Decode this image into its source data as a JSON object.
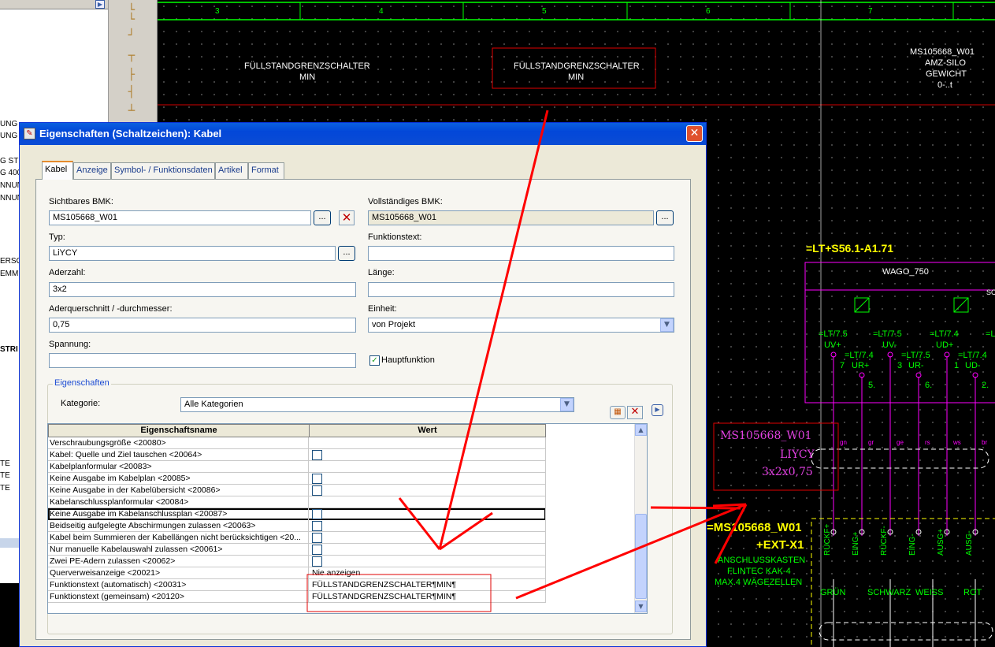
{
  "left_panel": {
    "texts": [
      "UNG",
      "UNG",
      "G STE",
      "G 400",
      "NNUN",
      "NNUN",
      "ERSC",
      "EMMI",
      "STRI",
      "TE",
      "TE",
      "TE"
    ]
  },
  "cad": {
    "columns": [
      "3",
      "4",
      "5",
      "6",
      "7"
    ],
    "switch1_line1": "FÜLLSTANDGRENZSCHALTER",
    "switch1_line2": "MIN",
    "switch2_line1": "FÜLLSTANDGRENZSCHALTER",
    "switch2_line2": "MIN",
    "silo_line1": "MS105668_W01",
    "silo_line2": "AMZ-SILO",
    "silo_line3": "GEWICHT",
    "silo_line4": "0-..t",
    "device_ref": "=LT+S56.1-A1.71",
    "wago": "WAGO_750",
    "wago_sc": "SC",
    "terminals_row1": [
      "=LT/7.5",
      "=LT/7.5",
      "=LT/7.4",
      "=LT"
    ],
    "terminals_row1b": [
      "UV+",
      "UV-",
      "UD+"
    ],
    "terminals_row2": [
      "7",
      "=LT/7.4",
      "3",
      "=LT/7.5",
      "1",
      "=LT/7.4"
    ],
    "terminals_row2b": [
      "UR+",
      "UR-",
      "UD-"
    ],
    "terminals_row3": [
      "5.",
      "6.",
      "2."
    ],
    "cable_bmk": "MS105668_W01",
    "cable_type": "LIYCY",
    "cable_size": "3x2x0,75",
    "wire_colors": [
      "gn",
      "gr",
      "ge",
      "rs",
      "ws",
      "br"
    ],
    "box_line1": "=MS105668_W01",
    "box_line2": "+EXT-X1",
    "box_line3": "ANSCHLUSSKASTEN",
    "box_line4": "FLINTEC KAK-4",
    "box_line5": "MAX.4 WÄGEZELLEN",
    "pins": [
      "RÜCKF+",
      "EING+",
      "RÜCKF-",
      "EING-",
      "AUSG+",
      "AUSG-"
    ],
    "colors_bottom": [
      "GRÜN",
      "SCHWARZ",
      "WEISS",
      "ROT"
    ]
  },
  "dialog": {
    "title": "Eigenschaften (Schaltzeichen): Kabel",
    "close_label": "✕",
    "tabs": [
      "Kabel",
      "Anzeige",
      "Symbol- / Funktionsdaten",
      "Artikel",
      "Format"
    ],
    "sichtbares_bmk_label": "Sichtbares BMK:",
    "sichtbares_bmk_value": "MS105668_W01",
    "vollstaendiges_bmk_label": "Vollständiges BMK:",
    "vollstaendiges_bmk_value": "MS105668_W01",
    "typ_label": "Typ:",
    "typ_value": "LiYCY",
    "funktionstext_label": "Funktionstext:",
    "funktionstext_value": "",
    "aderzahl_label": "Aderzahl:",
    "aderzahl_value": "3x2",
    "laenge_label": "Länge:",
    "laenge_value": "",
    "aderquerschnitt_label": "Aderquerschnitt / -durchmesser:",
    "aderquerschnitt_value": "0,75",
    "einheit_label": "Einheit:",
    "einheit_value": "von Projekt",
    "spannung_label": "Spannung:",
    "spannung_value": "",
    "hauptfunktion_label": "Hauptfunktion",
    "hauptfunktion_checked": true,
    "ellipsis": "...",
    "group_title": "Eigenschaften",
    "kategorie_label": "Kategorie:",
    "kategorie_value": "Alle Kategorien",
    "grid": {
      "col_name": "Eigenschaftsname",
      "col_value": "Wert",
      "rows": [
        {
          "name": "Verschraubungsgröße <20080>",
          "value": "",
          "type": "text"
        },
        {
          "name": "Kabel: Quelle und Ziel tauschen <20064>",
          "value": "",
          "type": "check"
        },
        {
          "name": "Kabelplanformular <20083>",
          "value": "",
          "type": "text"
        },
        {
          "name": "Keine Ausgabe im Kabelplan <20085>",
          "value": "",
          "type": "check"
        },
        {
          "name": "Keine Ausgabe in der Kabelübersicht <20086>",
          "value": "",
          "type": "check"
        },
        {
          "name": "Kabelanschlussplanformular <20084>",
          "value": "",
          "type": "text"
        },
        {
          "name": "Keine Ausgabe im Kabelanschlussplan <20087>",
          "value": "",
          "type": "check"
        },
        {
          "name": "Beidseitig aufgelegte Abschirmungen zulassen <20063>",
          "value": "",
          "type": "check"
        },
        {
          "name": "Kabel beim Summieren der Kabellängen nicht berücksichtigen <20...",
          "value": "",
          "type": "check"
        },
        {
          "name": "Nur manuelle Kabelauswahl zulassen <20061>",
          "value": "",
          "type": "check"
        },
        {
          "name": "Zwei PE-Adern zulassen <20062>",
          "value": "",
          "type": "check"
        },
        {
          "name": "Querverweisanzeige <20021>",
          "value": "Nie anzeigen",
          "type": "text"
        },
        {
          "name": "Funktionstext (automatisch) <20031>",
          "value": "FÜLLSTANDGRENZSCHALTER¶MIN¶",
          "type": "text"
        },
        {
          "name": "Funktionstext (gemeinsam) <20120>",
          "value": "FÜLLSTANDGRENZSCHALTER¶MIN¶",
          "type": "text"
        }
      ]
    }
  }
}
